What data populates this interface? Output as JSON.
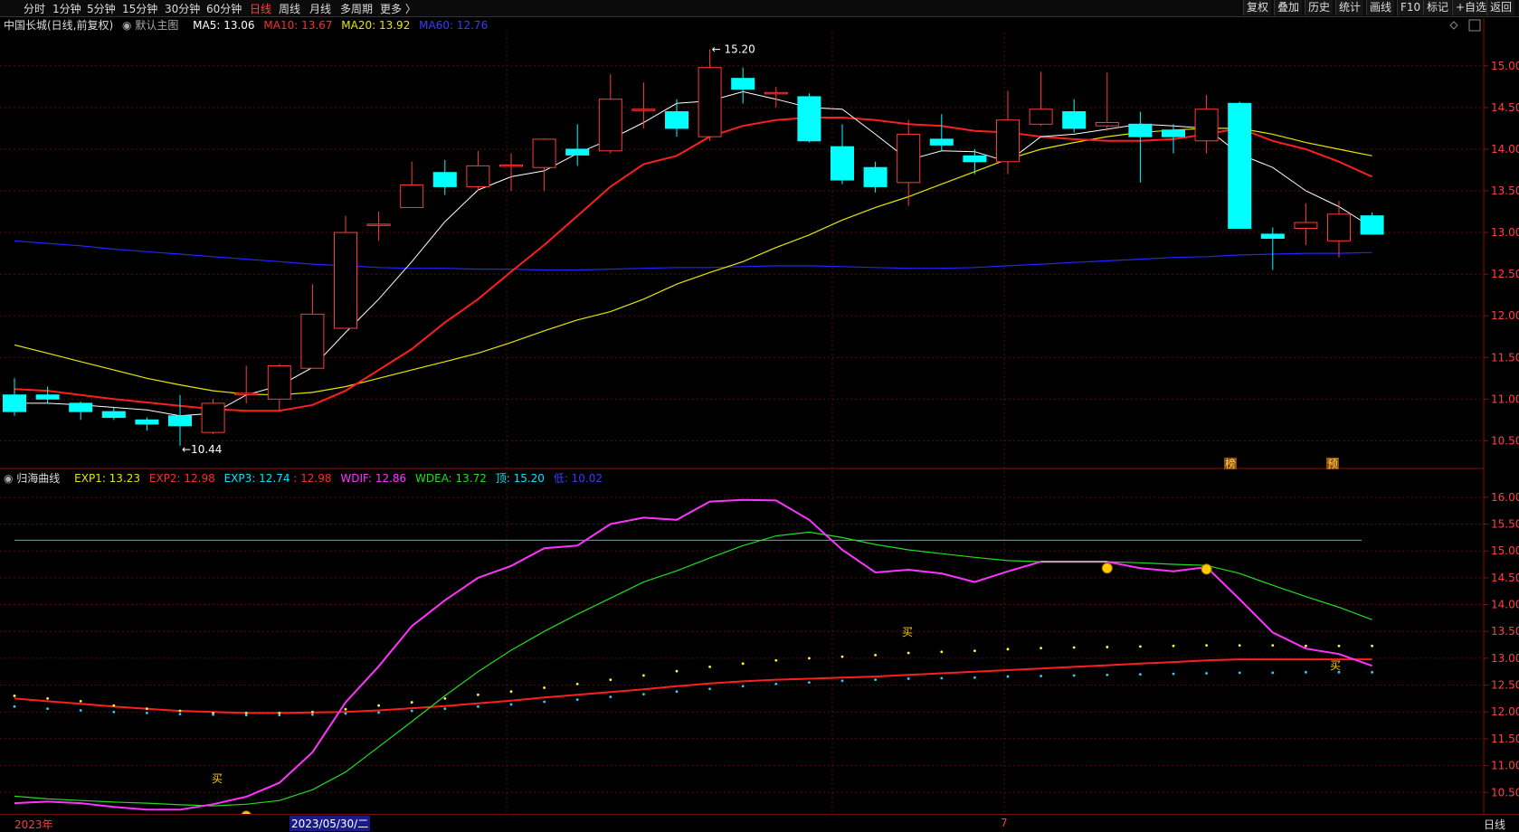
{
  "toolbar": {
    "periods": [
      "分时",
      "1分钟",
      "5分钟",
      "15分钟",
      "30分钟",
      "60分钟",
      "日线",
      "周线",
      "月线",
      "多周期",
      "更多 〉"
    ],
    "active_index": 6,
    "right_buttons": [
      "复权",
      "叠加",
      "历史",
      "统计",
      "画线",
      "F10",
      "标记",
      "+自选",
      "返回"
    ]
  },
  "main_legend": {
    "stock": "中国长城(日线,前复权)",
    "template": "默认主图",
    "ma5": "MA5: 13.06",
    "ma10": "MA10: 13.67",
    "ma20": "MA20: 13.92",
    "ma60": "MA60: 12.76"
  },
  "sub_legend": {
    "name": "归海曲线",
    "exp1": "EXP1: 13.23",
    "exp2": "EXP2: 12.98",
    "exp3": "EXP3: 12.74",
    "exp3b": ": 12.98",
    "wdif": "WDIF: 12.86",
    "wdea": "WDEA: 13.72",
    "top": "顶: 15.20",
    "low": "低: 10.02"
  },
  "colors": {
    "up": "#ff3b3b",
    "down": "#00ffff",
    "ma5": "#ffffff",
    "ma10": "#ff1e1e",
    "ma20": "#e6e600",
    "ma60": "#2424ff",
    "wdif": "#ff33ff",
    "wdea": "#22dd22",
    "grid": "#5a0a0a"
  },
  "chart_data": [
    {
      "type": "candlestick",
      "yticks": [
        "15.00",
        "14.50",
        "14.00",
        "13.50",
        "13.00",
        "12.50",
        "12.00",
        "11.50",
        "11.00",
        "10.50"
      ],
      "ylim": [
        10.2,
        15.4
      ],
      "candles": [
        [
          11.05,
          10.85,
          11.25,
          10.8
        ],
        [
          11.05,
          11.0,
          11.15,
          10.95
        ],
        [
          10.95,
          10.85,
          10.97,
          10.75
        ],
        [
          10.85,
          10.78,
          10.9,
          10.75
        ],
        [
          10.75,
          10.7,
          10.78,
          10.62
        ],
        [
          10.8,
          10.68,
          11.05,
          10.44
        ],
        [
          10.6,
          10.95,
          11.0,
          10.58
        ],
        [
          11.07,
          11.07,
          11.4,
          10.95
        ],
        [
          11.0,
          11.4,
          11.42,
          10.85
        ],
        [
          11.37,
          12.02,
          12.38,
          11.37
        ],
        [
          11.85,
          13.0,
          13.2,
          11.85
        ],
        [
          13.1,
          13.1,
          13.25,
          12.9
        ],
        [
          13.3,
          13.57,
          13.85,
          13.3
        ],
        [
          13.72,
          13.55,
          13.87,
          13.45
        ],
        [
          13.55,
          13.8,
          13.98,
          13.5
        ],
        [
          13.81,
          13.81,
          13.95,
          13.5
        ],
        [
          13.78,
          14.12,
          14.13,
          13.5
        ],
        [
          14.0,
          13.93,
          14.3,
          13.8
        ],
        [
          13.98,
          14.6,
          14.9,
          13.95
        ],
        [
          14.48,
          14.48,
          14.8,
          14.25
        ],
        [
          14.45,
          14.25,
          14.6,
          14.15
        ],
        [
          14.15,
          14.98,
          15.2,
          14.1
        ],
        [
          14.85,
          14.72,
          14.98,
          14.55
        ],
        [
          14.68,
          14.68,
          14.75,
          14.5
        ],
        [
          14.63,
          14.1,
          14.67,
          14.08
        ],
        [
          14.03,
          13.63,
          14.3,
          13.58
        ],
        [
          13.78,
          13.55,
          13.85,
          13.48
        ],
        [
          13.6,
          14.18,
          14.35,
          13.32
        ],
        [
          14.12,
          14.05,
          14.42,
          13.98
        ],
        [
          13.92,
          13.85,
          14.0,
          13.7
        ],
        [
          13.85,
          14.35,
          14.7,
          13.7
        ],
        [
          14.3,
          14.48,
          14.93,
          14.28
        ],
        [
          14.45,
          14.25,
          14.6,
          14.2
        ],
        [
          14.28,
          14.32,
          14.92,
          14.22
        ],
        [
          14.3,
          14.15,
          14.45,
          13.6
        ],
        [
          14.23,
          14.15,
          14.3,
          13.95
        ],
        [
          14.1,
          14.48,
          14.65,
          13.95
        ],
        [
          14.55,
          13.05,
          14.57,
          13.05
        ],
        [
          12.98,
          12.93,
          13.06,
          12.55
        ],
        [
          13.05,
          13.12,
          13.35,
          12.85
        ],
        [
          12.9,
          13.22,
          13.38,
          12.7
        ],
        [
          13.2,
          12.98,
          13.24,
          12.98
        ]
      ],
      "ma5": [
        10.95,
        10.95,
        10.93,
        10.9,
        10.87,
        10.8,
        10.83,
        11.05,
        11.16,
        11.38,
        11.8,
        12.2,
        12.65,
        13.13,
        13.51,
        13.67,
        13.74,
        13.95,
        14.12,
        14.32,
        14.55,
        14.58,
        14.69,
        14.6,
        14.5,
        14.48,
        14.18,
        13.87,
        13.98,
        13.97,
        13.85,
        14.15,
        14.18,
        14.24,
        14.3,
        14.28,
        14.25,
        13.94,
        13.78,
        13.5,
        13.31,
        13.06
      ],
      "ma10": [
        11.12,
        11.1,
        11.05,
        11.0,
        10.96,
        10.92,
        10.88,
        10.86,
        10.86,
        10.93,
        11.1,
        11.35,
        11.6,
        11.92,
        12.2,
        12.53,
        12.85,
        13.2,
        13.55,
        13.82,
        13.92,
        14.15,
        14.28,
        14.35,
        14.38,
        14.38,
        14.35,
        14.3,
        14.28,
        14.22,
        14.2,
        14.15,
        14.12,
        14.1,
        14.1,
        14.12,
        14.18,
        14.25,
        14.1,
        14.0,
        13.85,
        13.67
      ],
      "ma20": [
        11.65,
        11.55,
        11.45,
        11.35,
        11.25,
        11.17,
        11.1,
        11.06,
        11.05,
        11.08,
        11.15,
        11.25,
        11.35,
        11.45,
        11.55,
        11.68,
        11.82,
        11.95,
        12.05,
        12.2,
        12.38,
        12.52,
        12.65,
        12.82,
        12.97,
        13.15,
        13.3,
        13.43,
        13.58,
        13.73,
        13.88,
        14.0,
        14.08,
        14.15,
        14.2,
        14.23,
        14.25,
        14.25,
        14.18,
        14.08,
        14.0,
        13.92
      ],
      "ma60": [
        12.9,
        12.87,
        12.84,
        12.8,
        12.77,
        12.74,
        12.71,
        12.68,
        12.65,
        12.62,
        12.6,
        12.58,
        12.57,
        12.57,
        12.56,
        12.56,
        12.55,
        12.55,
        12.56,
        12.57,
        12.58,
        12.58,
        12.59,
        12.6,
        12.6,
        12.59,
        12.58,
        12.57,
        12.57,
        12.58,
        12.6,
        12.62,
        12.64,
        12.66,
        12.68,
        12.7,
        12.71,
        12.73,
        12.74,
        12.75,
        12.75,
        12.76
      ],
      "annotations": {
        "high": "15.20",
        "low": "10.44",
        "marker1": "榜",
        "marker2": "预"
      }
    },
    {
      "type": "line",
      "yticks": [
        "16.00",
        "15.50",
        "15.00",
        "14.50",
        "14.00",
        "13.50",
        "13.00",
        "12.50",
        "12.00",
        "11.50",
        "11.00",
        "10.50"
      ],
      "ylim": [
        10.1,
        16.2
      ],
      "top_line": 15.2,
      "low_line": 10.02,
      "wdif": [
        10.3,
        10.33,
        10.3,
        10.23,
        10.18,
        10.18,
        10.28,
        10.42,
        10.68,
        11.25,
        12.18,
        12.85,
        13.6,
        14.08,
        14.5,
        14.72,
        15.05,
        15.1,
        15.5,
        15.62,
        15.58,
        15.92,
        15.95,
        15.94,
        15.58,
        15.02,
        14.6,
        14.65,
        14.58,
        14.42,
        14.62,
        14.8,
        14.8,
        14.8,
        14.68,
        14.62,
        14.7,
        14.1,
        13.48,
        13.18,
        13.08,
        12.86
      ],
      "wdea": [
        10.43,
        10.38,
        10.35,
        10.32,
        10.3,
        10.27,
        10.25,
        10.28,
        10.35,
        10.55,
        10.88,
        11.35,
        11.82,
        12.3,
        12.75,
        13.15,
        13.5,
        13.82,
        14.12,
        14.42,
        14.63,
        14.87,
        15.1,
        15.28,
        15.35,
        15.25,
        15.12,
        15.02,
        14.95,
        14.88,
        14.82,
        14.8,
        14.8,
        14.8,
        14.78,
        14.75,
        14.73,
        14.58,
        14.36,
        14.15,
        13.95,
        13.72
      ],
      "exp1": [
        12.3,
        12.25,
        12.2,
        12.12,
        12.06,
        12.02,
        11.98,
        11.98,
        11.98,
        12.0,
        12.05,
        12.12,
        12.18,
        12.25,
        12.32,
        12.38,
        12.45,
        12.52,
        12.6,
        12.68,
        12.76,
        12.84,
        12.9,
        12.96,
        13.0,
        13.03,
        13.06,
        13.1,
        13.12,
        13.14,
        13.17,
        13.19,
        13.2,
        13.21,
        13.22,
        13.23,
        13.24,
        13.24,
        13.24,
        13.23,
        13.23,
        13.23
      ],
      "exp2": [
        12.25,
        12.2,
        12.15,
        12.1,
        12.06,
        12.02,
        12.0,
        11.98,
        11.98,
        11.99,
        12.0,
        12.03,
        12.07,
        12.11,
        12.16,
        12.21,
        12.27,
        12.32,
        12.37,
        12.42,
        12.48,
        12.53,
        12.57,
        12.6,
        12.62,
        12.64,
        12.66,
        12.69,
        12.72,
        12.75,
        12.78,
        12.81,
        12.84,
        12.87,
        12.9,
        12.93,
        12.96,
        12.98,
        12.98,
        12.98,
        12.98,
        12.98
      ],
      "exp3": [
        12.1,
        12.06,
        12.03,
        12.0,
        11.98,
        11.96,
        11.95,
        11.94,
        11.94,
        11.95,
        11.97,
        11.99,
        12.02,
        12.06,
        12.1,
        12.14,
        12.19,
        12.23,
        12.28,
        12.33,
        12.38,
        12.43,
        12.48,
        12.52,
        12.55,
        12.58,
        12.6,
        12.62,
        12.63,
        12.64,
        12.66,
        12.67,
        12.68,
        12.69,
        12.7,
        12.71,
        12.72,
        12.73,
        12.73,
        12.74,
        12.74,
        12.74
      ],
      "signals": {
        "buy1": "买",
        "buy2": "买",
        "buy3": "买"
      }
    }
  ],
  "bottom": {
    "year": "2023年",
    "date": "2023/05/30/二",
    "month": "7",
    "period": "日线"
  }
}
